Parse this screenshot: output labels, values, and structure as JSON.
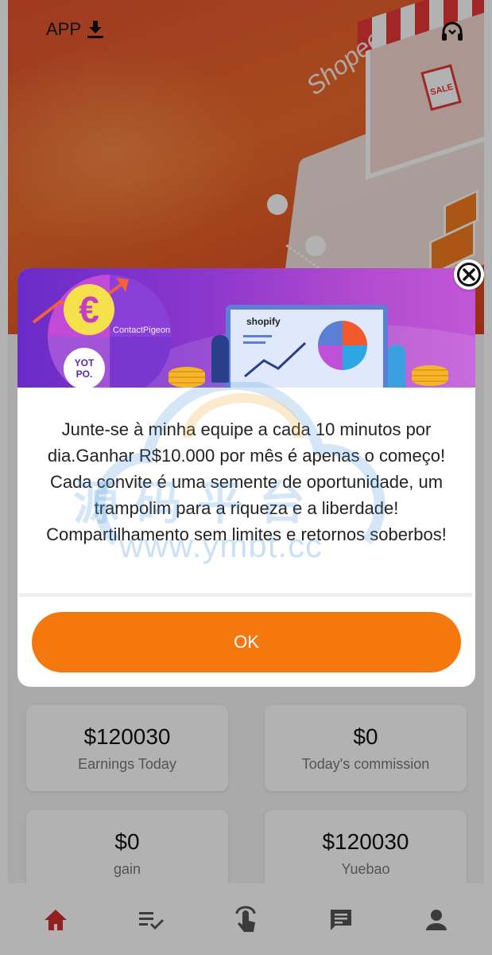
{
  "header": {
    "app_label": "APP",
    "download_icon": "download-icon",
    "support_icon": "headset-icon"
  },
  "hero": {
    "brand_sign": "Shopee",
    "sale_tag": "SALE"
  },
  "stats": [
    {
      "value": "$120030",
      "label": "Earnings Today"
    },
    {
      "value": "$0",
      "label": "Today's commission"
    },
    {
      "value": "$0",
      "label": "gain"
    },
    {
      "value": "$120030",
      "label": "Yuebao"
    }
  ],
  "bottom_nav": [
    {
      "icon": "home-icon",
      "active": true
    },
    {
      "icon": "task-list-icon",
      "active": false
    },
    {
      "icon": "tap-icon",
      "active": false
    },
    {
      "icon": "message-icon",
      "active": false
    },
    {
      "icon": "profile-icon",
      "active": false
    }
  ],
  "modal": {
    "banner": {
      "euro_symbol": "€",
      "brand_pigeon": "ContactPigeon",
      "brand_yotpo_1": "YOT",
      "brand_yotpo_2": "PO.",
      "brand_shopify": "shopify"
    },
    "message": "Junte-se à minha equipe a cada 10 minutos por dia.Ganhar R$10.000 por mês é apenas o começo!  Cada convite é uma semente de oportunidade, um trampolim para a riqueza e a liberdade! Compartilhamento sem limites e retornos soberbos!",
    "ok_label": "OK",
    "close_icon": "close-icon"
  },
  "watermark": {
    "text_cn": "源码平台",
    "url": "www.ymbt.cc"
  },
  "colors": {
    "accent": "#f5780e",
    "hero": "#e5532f",
    "nav_active": "#d32f2f",
    "nav_inactive": "#555555",
    "modal_banner": "#8a36cc"
  }
}
